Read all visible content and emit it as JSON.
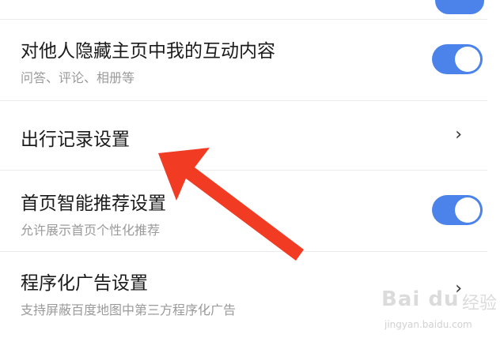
{
  "settings": [
    {
      "title": "对他人隐藏主页中我的互动内容",
      "subtitle": "问答、评论、相册等",
      "control": "toggle",
      "toggle_on": true
    },
    {
      "title": "出行记录设置",
      "subtitle": "",
      "control": "chevron",
      "chevron": "›"
    },
    {
      "title": "首页智能推荐设置",
      "subtitle": "允许展示首页个性化推荐",
      "control": "toggle",
      "toggle_on": true
    },
    {
      "title": "程序化广告设置",
      "subtitle": "支持屏蔽百度地图中第三方程序化广告",
      "control": "chevron",
      "chevron": "›"
    }
  ],
  "colors": {
    "toggle_on": "#4c83ea",
    "annotation_arrow": "#f23b23"
  },
  "watermark": {
    "logo": "Bai du",
    "text": "经验",
    "url": "jingyan.baidu.com"
  }
}
